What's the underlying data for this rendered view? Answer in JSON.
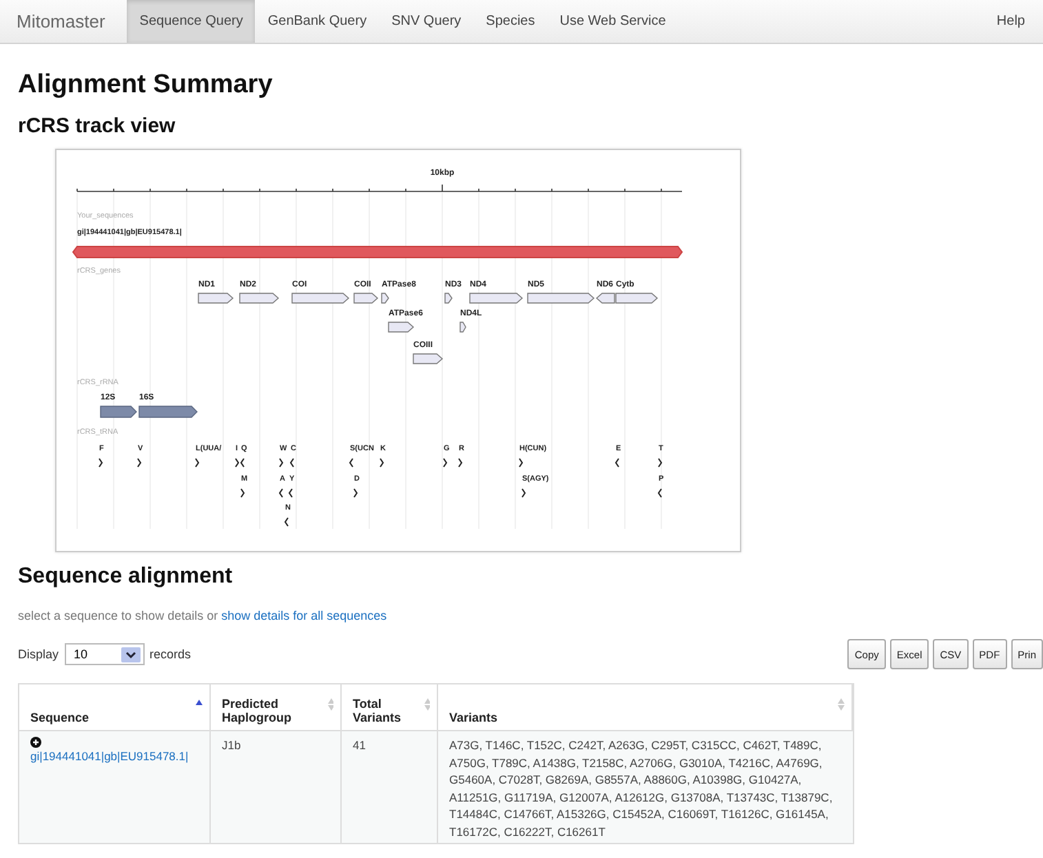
{
  "nav": {
    "brand": "Mitomaster",
    "tabs": [
      {
        "label": "Sequence Query",
        "selected": true
      },
      {
        "label": "GenBank Query",
        "selected": false
      },
      {
        "label": "SNV Query",
        "selected": false
      },
      {
        "label": "Species",
        "selected": false
      },
      {
        "label": "Use Web Service",
        "selected": false
      }
    ],
    "help": "Help"
  },
  "page_title": "Alignment Summary",
  "track_view": {
    "title": "rCRS track view",
    "ruler_label": "10kbp",
    "sequences_track": {
      "label": "Your_sequences",
      "sequences": [
        {
          "name": "gi|194441041|gb|EU915478.1|"
        }
      ]
    },
    "genes_track": {
      "label": "rCRS_genes",
      "genes": [
        {
          "name": "ND1",
          "reverse": false
        },
        {
          "name": "ND2",
          "reverse": false
        },
        {
          "name": "COI",
          "reverse": false
        },
        {
          "name": "COII",
          "reverse": false
        },
        {
          "name": "ATPase8",
          "reverse": false
        },
        {
          "name": "ND3",
          "reverse": false
        },
        {
          "name": "ND4",
          "reverse": false
        },
        {
          "name": "ND5",
          "reverse": false
        },
        {
          "name": "ND6",
          "reverse": true
        },
        {
          "name": "Cytb",
          "reverse": false
        },
        {
          "name": "ATPase6",
          "reverse": false
        },
        {
          "name": "ND4L",
          "reverse": false
        },
        {
          "name": "COIII",
          "reverse": false
        }
      ]
    },
    "rrna_track": {
      "label": "rCRS_rRNA",
      "rrnas": [
        {
          "name": "12S",
          "reverse": false
        },
        {
          "name": "16S",
          "reverse": false
        }
      ]
    },
    "trna_track": {
      "label": "rCRS_tRNA",
      "trnas": [
        {
          "name": "F",
          "reverse": false
        },
        {
          "name": "V",
          "reverse": false
        },
        {
          "name": "L(UUA/",
          "reverse": false
        },
        {
          "name": "I",
          "reverse": false
        },
        {
          "name": "Q",
          "reverse": true
        },
        {
          "name": "M",
          "reverse": false
        },
        {
          "name": "W",
          "reverse": false
        },
        {
          "name": "C",
          "reverse": true
        },
        {
          "name": "A",
          "reverse": true
        },
        {
          "name": "Y",
          "reverse": true
        },
        {
          "name": "N",
          "reverse": true
        },
        {
          "name": "S(UCN",
          "reverse": true
        },
        {
          "name": "K",
          "reverse": false
        },
        {
          "name": "D",
          "reverse": false
        },
        {
          "name": "G",
          "reverse": false
        },
        {
          "name": "R",
          "reverse": false
        },
        {
          "name": "H(CUN)",
          "reverse": false
        },
        {
          "name": "S(AGY)",
          "reverse": false
        },
        {
          "name": "E",
          "reverse": true
        },
        {
          "name": "T",
          "reverse": false
        },
        {
          "name": "P",
          "reverse": true
        }
      ]
    }
  },
  "alignment": {
    "title": "Sequence alignment",
    "hint": "select a sequence to show details or",
    "hint_link": "show details for all sequences",
    "display": {
      "label_before": "Display",
      "value": "10",
      "label_after": "records"
    },
    "export_buttons": [
      "Copy",
      "Excel",
      "CSV",
      "PDF",
      "Prin"
    ],
    "table": {
      "columns": [
        {
          "label": "Sequence",
          "sorted": true
        },
        {
          "label": "Predicted Haplogroup",
          "sorted": false
        },
        {
          "label": "Total Variants",
          "sorted": false
        },
        {
          "label": "Variants",
          "sorted": false
        }
      ],
      "rows": [
        {
          "sequence": "gi|194441041|gb|EU915478.1|",
          "haplogroup": "J1b",
          "total_variants": "41",
          "variants": "A73G, T146C, T152C, C242T, A263G, C295T, C315CC, C462T, T489C, A750G, T789C, A1438G, T2158C, A2706G, G3010A, T4216C, A4769G, G5460A, C7028T, G8269A, G8557A, A8860G, A10398G, G10427A, A11251G, G11719A, G12007A, A12612G, G13708A, T13743C, T13879C, T14484C, C14766T, A15326G, C15452A, C16069T, T16126C, G16145A, T16172C, C16222T, C16261T"
        }
      ]
    }
  }
}
